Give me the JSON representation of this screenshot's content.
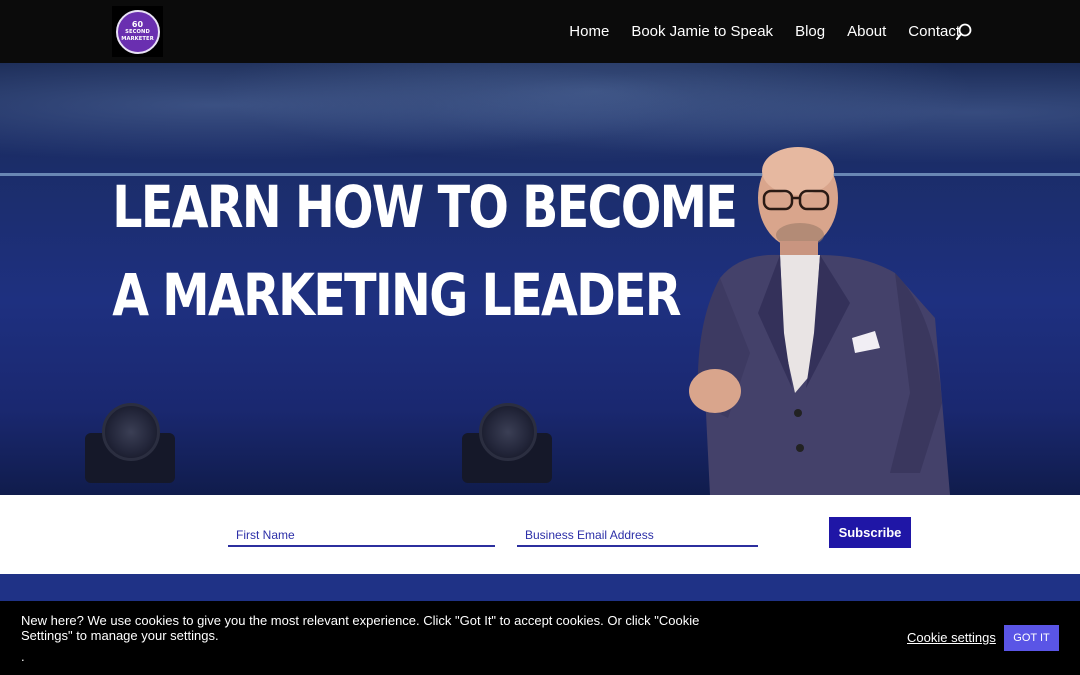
{
  "header": {
    "logo_number": "60",
    "logo_line1": "SECOND",
    "logo_line2": "MARKETER",
    "nav": [
      "Home",
      "Book Jamie to Speak",
      "Blog",
      "About",
      "Contact"
    ],
    "search_icon": "search-icon"
  },
  "hero": {
    "title_line1": "LEARN HOW TO BECOME",
    "title_line2": "A MARKETING LEADER"
  },
  "form": {
    "first_name_placeholder": "First Name",
    "email_placeholder": "Business Email Address",
    "subscribe_label": "Subscribe"
  },
  "cookie": {
    "message": "New here? We use cookies to give you the most relevant experience. Click \"Got It\" to accept cookies. Or click \"Cookie Settings\" to manage your settings.",
    "dot": ".",
    "settings_label": "Cookie settings",
    "accept_label": "GOT IT"
  },
  "colors": {
    "header_bg": "#0b0b0b",
    "hero_blue": "#1e3080",
    "subscribe_bg": "#1f16a6",
    "gotit_bg": "#5a55e6",
    "band_blue": "#1f3286"
  }
}
